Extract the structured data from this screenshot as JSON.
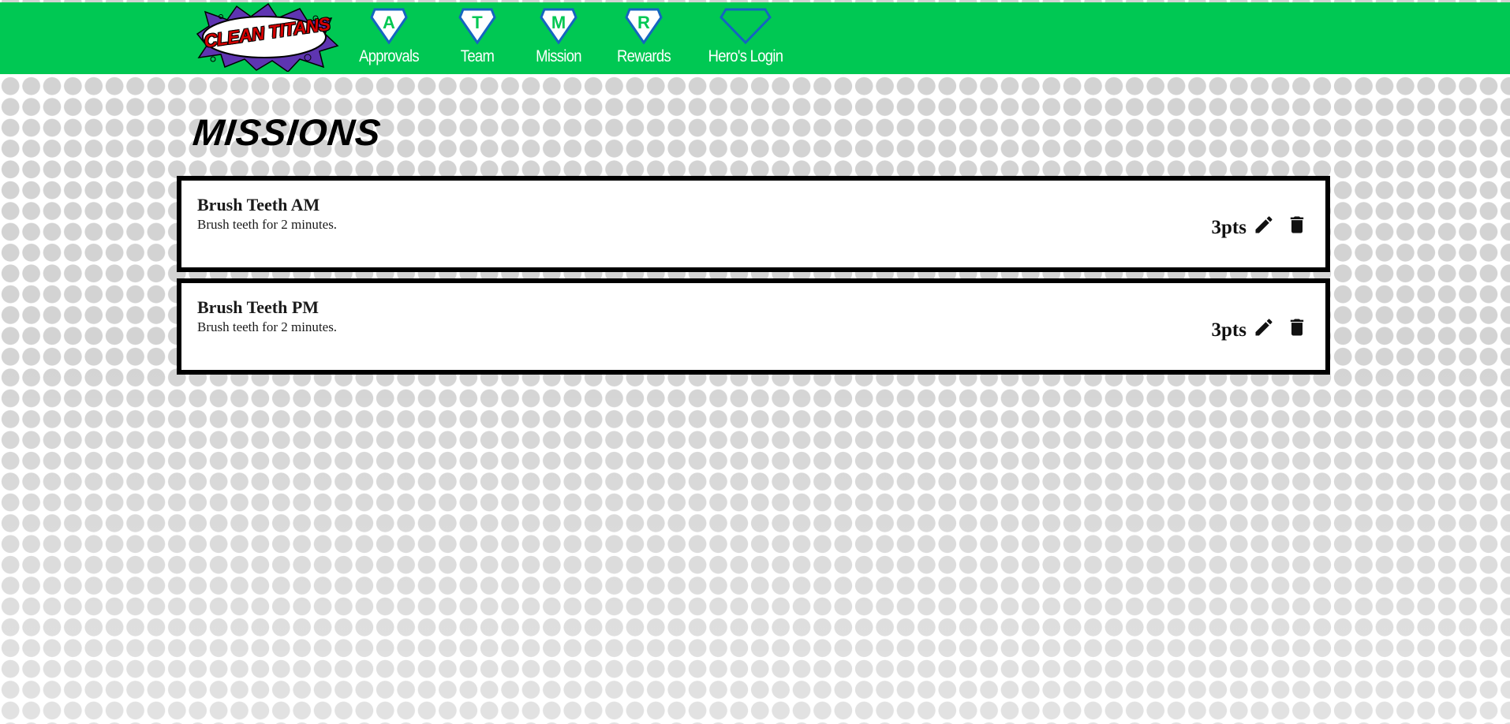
{
  "brand": {
    "logo_text": "CLEAN TITANS"
  },
  "nav": {
    "items": [
      {
        "letter": "A",
        "label": "Approvals"
      },
      {
        "letter": "T",
        "label": "Team"
      },
      {
        "letter": "M",
        "label": "Mission"
      },
      {
        "letter": "R",
        "label": "Rewards"
      },
      {
        "letter": "",
        "label": "Hero's Login"
      }
    ]
  },
  "page": {
    "title": "MISSIONS"
  },
  "missions": [
    {
      "title": "Brush Teeth AM",
      "description": "Brush teeth for 2 minutes.",
      "points": "3pts"
    },
    {
      "title": "Brush Teeth PM",
      "description": "Brush teeth for 2 minutes.",
      "points": "3pts"
    }
  ],
  "colors": {
    "header_bg": "#00c853",
    "diamond_outline": "#1565c0",
    "logo_text": "#d50000",
    "logo_burst": "#5e35b1",
    "dot": "#d3d3d3"
  },
  "icons": {
    "edit": "pencil-icon",
    "delete": "trash-icon",
    "nav_badge": "diamond-icon"
  }
}
